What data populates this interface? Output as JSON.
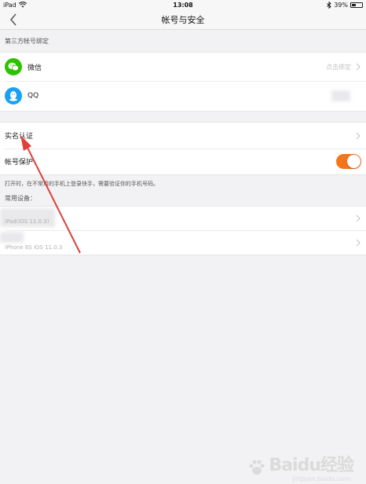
{
  "status_bar": {
    "carrier": "iPad",
    "time": "13:08",
    "battery_text": "39%",
    "battery_level": 0.39
  },
  "nav": {
    "title": "帐号与安全"
  },
  "third_party": {
    "header": "第三方帐号绑定",
    "wechat_label": "微信",
    "wechat_action": "点击绑定",
    "qq_label": "QQ"
  },
  "verification": {
    "label": "实名认证"
  },
  "protection": {
    "label": "帐号保护",
    "enabled": true,
    "hint": "打开时，在不常用的手机上登录快手，需要验证你的手机号码。"
  },
  "devices": {
    "header": "常用设备：",
    "items": [
      {
        "text": "iPad(iOS 11.0.3)"
      },
      {
        "text": "iPhone 6S iOS 11.0.3"
      }
    ]
  },
  "watermark": {
    "logo": "Baidu经验",
    "sub": "jingyan.baidu.com"
  },
  "colors": {
    "accent": "#f5761a",
    "wechat": "#2dc100",
    "qq": "#1aa1f0",
    "annotation_arrow": "#e0403a"
  }
}
